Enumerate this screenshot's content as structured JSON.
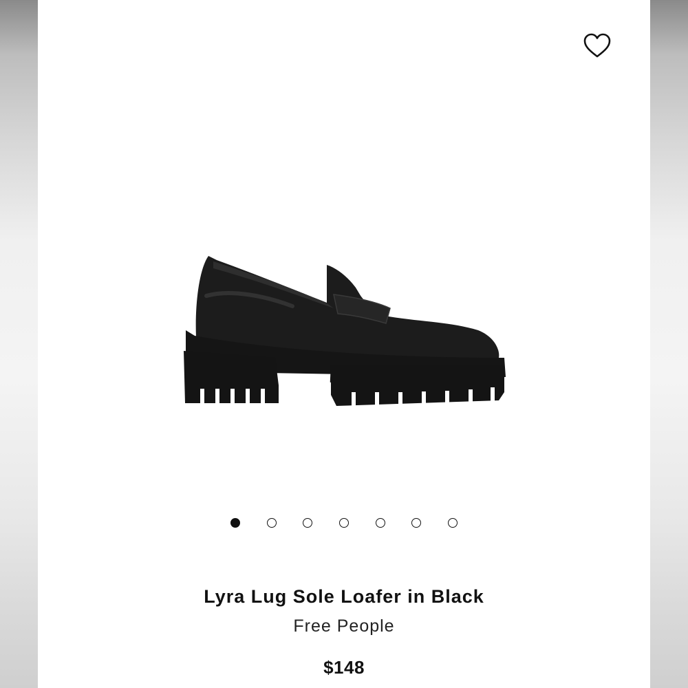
{
  "product": {
    "title": "Lyra Lug Sole Loafer in Black",
    "brand": "Free People",
    "price": "$148",
    "image_alt": "black leather lug sole loafer"
  },
  "gallery": {
    "image_count": 7,
    "active_index": 0
  },
  "icons": {
    "wishlist": "heart-outline-icon"
  },
  "colors": {
    "text": "#111111",
    "shoe": "#1c1c1c"
  }
}
